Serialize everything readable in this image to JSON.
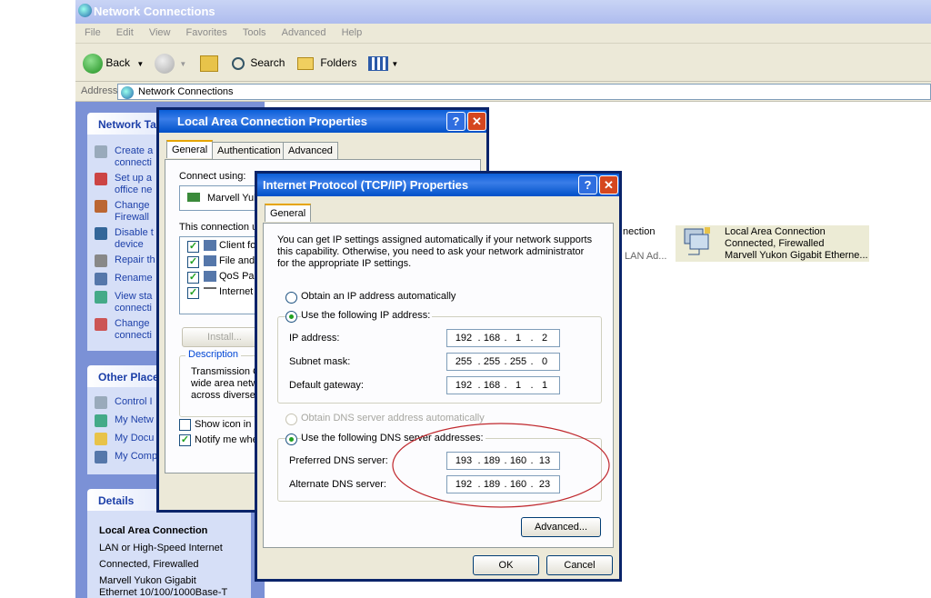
{
  "explorer": {
    "title": "Network Connections",
    "menu": [
      "File",
      "Edit",
      "View",
      "Favorites",
      "Tools",
      "Advanced",
      "Help"
    ],
    "toolbar": {
      "back": "Back",
      "search": "Search",
      "folders": "Folders"
    },
    "address_label": "Address",
    "address_value": "Network Connections"
  },
  "leftpane": {
    "network_tasks_header": "Network Ta",
    "tasks": [
      "Create a\nconnecti",
      "Set up a\noffice ne",
      "Change\nFirewall",
      "Disable t\ndevice",
      "Repair th",
      "Rename",
      "View sta\nconnecti",
      "Change\nconnecti"
    ],
    "other_places_header": "Other Place",
    "other_places": [
      "Control I",
      "My Netw",
      "My Docu",
      "My Comp"
    ],
    "details_header": "Details",
    "details_title": "Local Area Connection",
    "details_lines": [
      "LAN or High-Speed Internet",
      "Connected, Firewalled",
      "Marvell Yukon Gigabit",
      "Ethernet 10/100/1000Base-T"
    ]
  },
  "connections": {
    "partial_name": "nection",
    "partial_sub": "LAN Ad...",
    "item": {
      "name": "Local Area Connection",
      "status": "Connected, Firewalled",
      "device": "Marvell Yukon Gigabit Etherne..."
    }
  },
  "lac_dialog": {
    "title": "Local Area Connection Properties",
    "tabs": [
      "General",
      "Authentication",
      "Advanced"
    ],
    "connect_using": "Connect using:",
    "adapter": "Marvell Yuk",
    "uses_label": "This connection u",
    "components": [
      "Client for",
      "File and I",
      "QoS Pac",
      "Internet F"
    ],
    "install_btn": "Install...",
    "description_label": "Description",
    "description_text": "Transmission C\nwide area netw\nacross diverse",
    "show_icon": "Show icon in n",
    "notify": "Notify me wher"
  },
  "tcpip_dialog": {
    "title": "Internet Protocol (TCP/IP) Properties",
    "tab": "General",
    "intro": "You can get IP settings assigned automatically if your network supports this capability. Otherwise, you need to ask your network administrator for the appropriate IP settings.",
    "obtain_ip": "Obtain an IP address automatically",
    "use_ip": "Use the following IP address:",
    "ip_label": "IP address:",
    "ip_value": [
      "192",
      "168",
      "1",
      "2"
    ],
    "subnet_label": "Subnet mask:",
    "subnet_value": [
      "255",
      "255",
      "255",
      "0"
    ],
    "gateway_label": "Default gateway:",
    "gateway_value": [
      "192",
      "168",
      "1",
      "1"
    ],
    "obtain_dns": "Obtain DNS server address automatically",
    "use_dns": "Use the following DNS server addresses:",
    "pref_dns_label": "Preferred DNS server:",
    "pref_dns_value": [
      "193",
      "189",
      "160",
      "13"
    ],
    "alt_dns_label": "Alternate DNS server:",
    "alt_dns_value": [
      "192",
      "189",
      "160",
      "23"
    ],
    "advanced_btn": "Advanced...",
    "ok_btn": "OK",
    "cancel_btn": "Cancel"
  },
  "colors": {
    "annotation": "#c0282d",
    "title_bar": "#0a5fd8"
  }
}
